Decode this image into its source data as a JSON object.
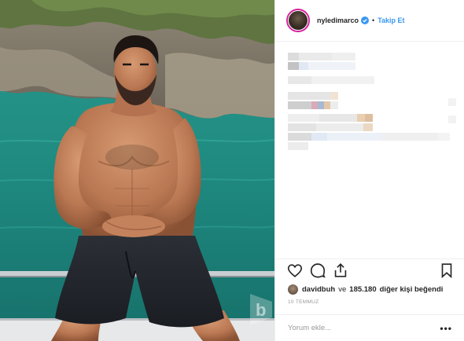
{
  "post": {
    "username": "nyledimarco",
    "verified": true,
    "follow_label": "Takip Et",
    "dot": "•"
  },
  "likes": {
    "liker": "davidbuh",
    "conjunction": "ve",
    "count": "185.180",
    "rest": "diğer kişi beğendi"
  },
  "date": "10 TEMMUZ",
  "comment": {
    "placeholder": "Yorum ekle...",
    "more_label": "•••"
  },
  "icons": {
    "like": "heart-icon",
    "comment": "comment-icon",
    "share": "share-icon",
    "save": "bookmark-icon",
    "verified": "verified-badge-icon"
  },
  "colors": {
    "accent": "#3897f0",
    "text": "#262626",
    "muted": "#999999",
    "divider": "#efefef"
  }
}
